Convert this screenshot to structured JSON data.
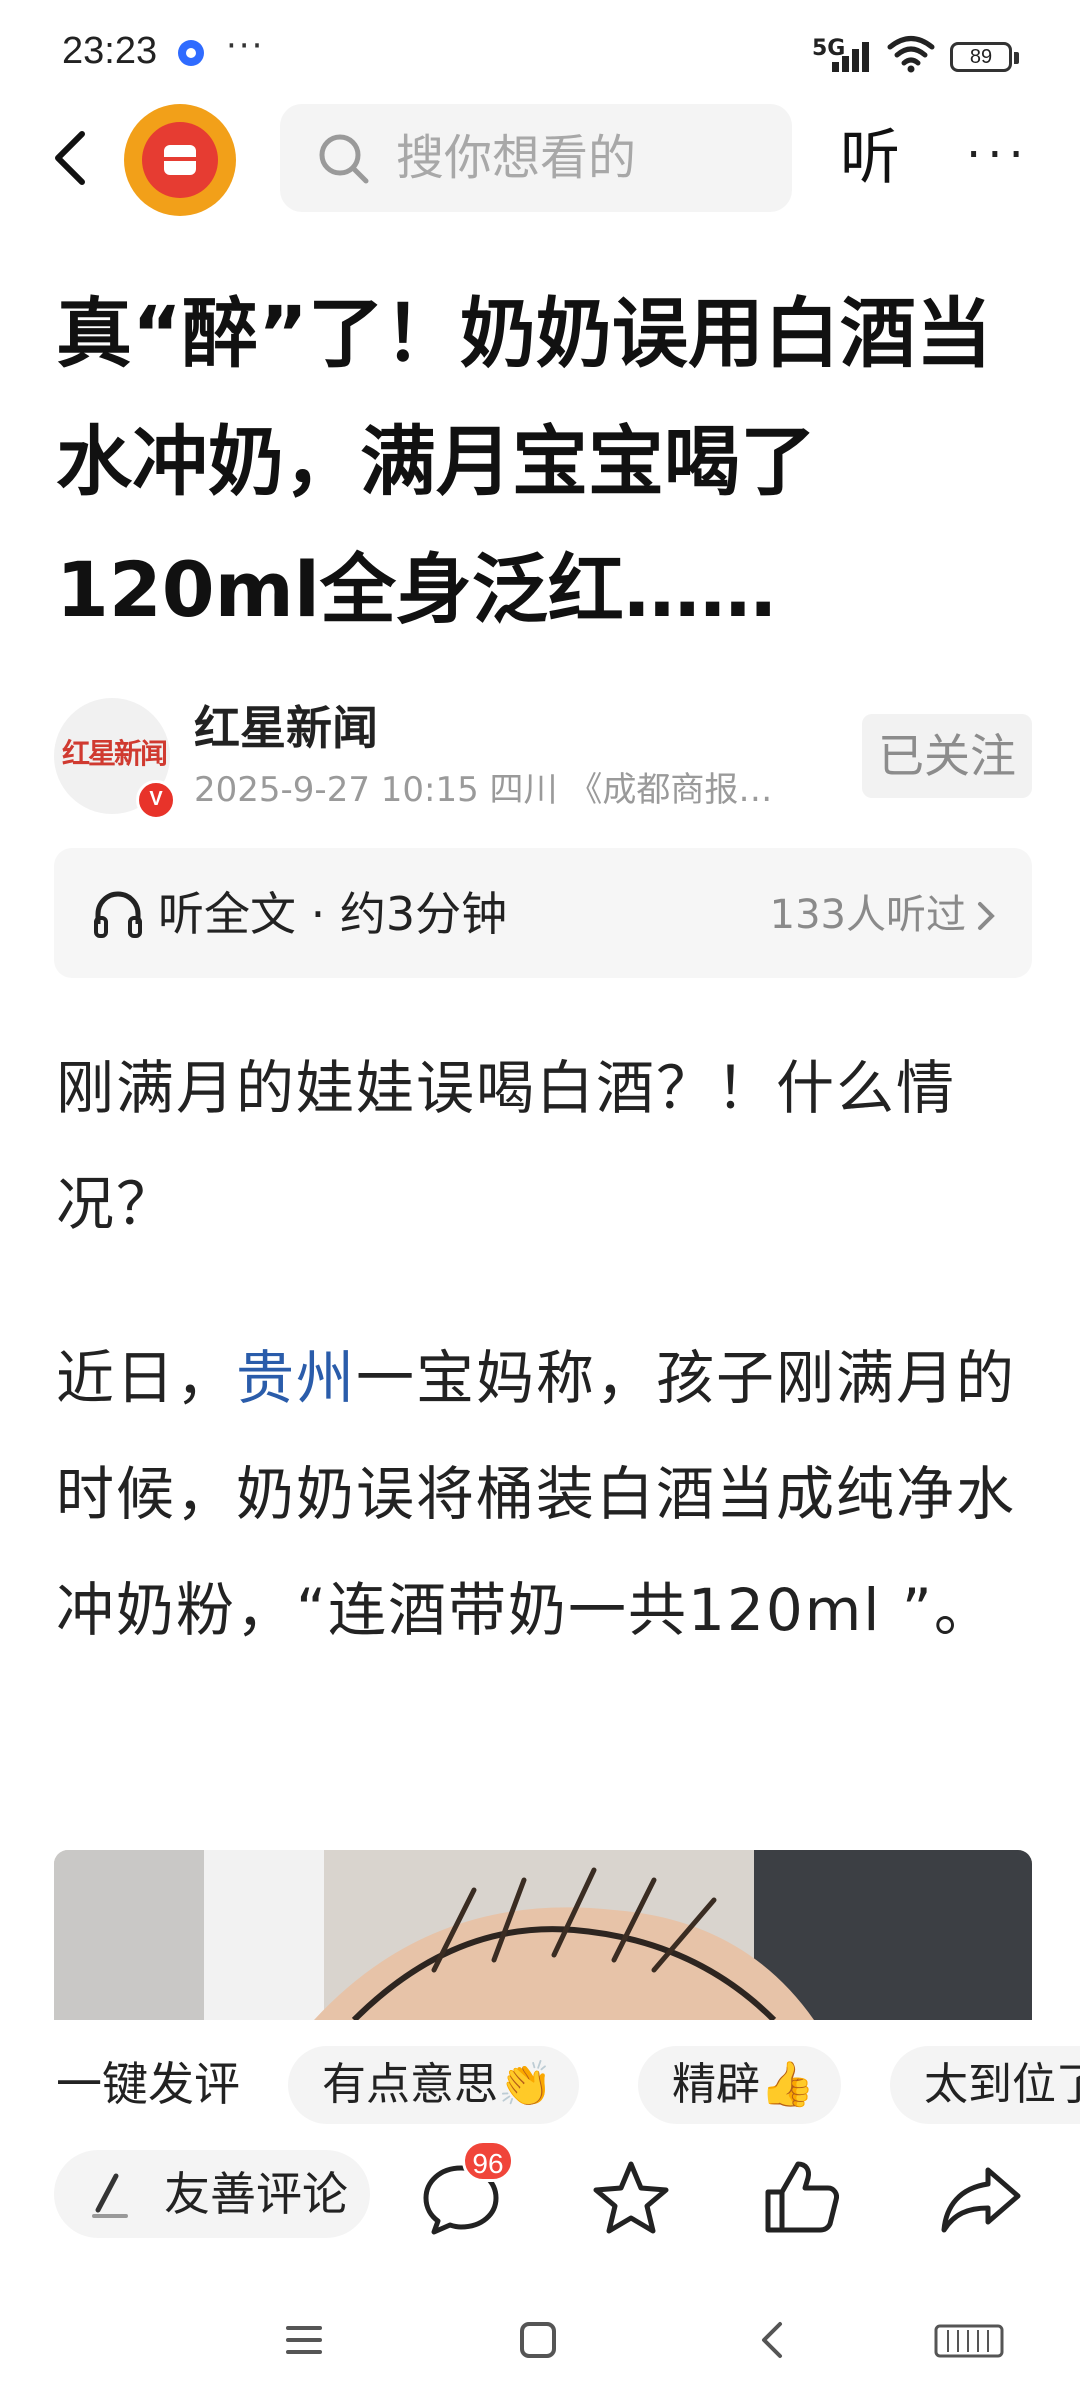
{
  "status_bar": {
    "time": "23:23",
    "more": "···",
    "network": "5G",
    "battery": "89"
  },
  "header": {
    "search_placeholder": "搜你想看的",
    "listen_label": "听",
    "more_label": "···"
  },
  "article": {
    "title": "真“醉”了！奶奶误用白酒当水冲奶，满月宝宝喝了120ml全身泛红……",
    "author": {
      "avatar_text": "红星新闻",
      "verified": "V",
      "name": "红星新闻",
      "meta": "2025-9-27  10:15  四川  《成都商报…",
      "follow_label": "已关注"
    },
    "listen_bar": {
      "label": "听全文 · 约3分钟",
      "count": "133人听过"
    },
    "paragraph1": "刚满月的娃娃误喝白酒？！什么情况？",
    "paragraph2": {
      "before": "近日，",
      "link": "贵州",
      "after": "一宝妈称，孩子刚满月的时候，奶奶误将桶装白酒当成纯净水冲奶粉，“连酒带奶一共120ml ”。"
    }
  },
  "quick_reply": {
    "label": "一键发评",
    "chips": [
      "有点意思👏",
      "精辟👍",
      "太到位了"
    ]
  },
  "action_bar": {
    "comment_placeholder": "友善评论",
    "comment_count": "96"
  },
  "icons": {
    "accent": "#e63c32",
    "link": "#2a5caa"
  }
}
